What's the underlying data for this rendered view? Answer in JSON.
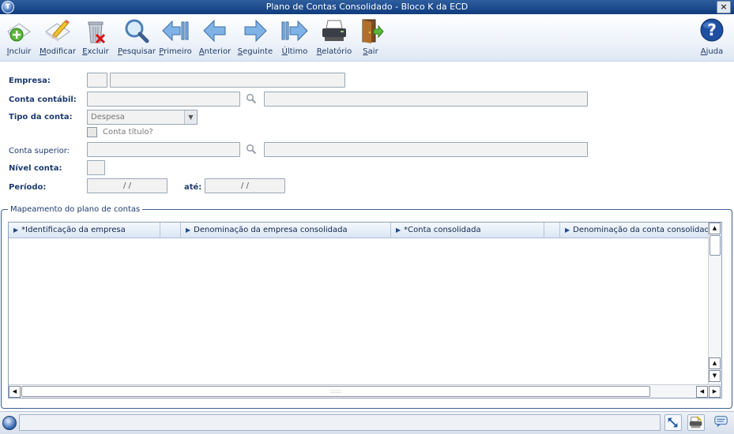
{
  "window": {
    "title": "Plano de Contas Consolidado - Bloco K da ECD",
    "close_label": "×",
    "app_icon_glyph": "T"
  },
  "toolbar": {
    "items": [
      {
        "label": "Incluir",
        "icon": "include-icon"
      },
      {
        "label": "Modificar",
        "icon": "modify-icon"
      },
      {
        "label": "Excluir",
        "icon": "delete-icon"
      },
      {
        "label": "Pesquisar",
        "icon": "search-icon"
      },
      {
        "label": "Primeiro",
        "icon": "first-icon"
      },
      {
        "label": "Anterior",
        "icon": "previous-icon"
      },
      {
        "label": "Seguinte",
        "icon": "next-icon"
      },
      {
        "label": "Último",
        "icon": "last-icon"
      },
      {
        "label": "Relatório",
        "icon": "printer-icon"
      },
      {
        "label": "Sair",
        "icon": "exit-door-icon"
      }
    ],
    "help_label": "Ajuda",
    "help_glyph": "?"
  },
  "form": {
    "empresa_label": "Empresa:",
    "conta_contabil_label": "Conta contábil:",
    "tipo_conta_label": "Tipo da conta:",
    "tipo_conta_value": "Despesa",
    "conta_titulo_label": "Conta título?",
    "conta_superior_label": "Conta superior:",
    "nivel_conta_label": "Nível conta:",
    "periodo_label": "Período:",
    "periodo_inicio_value": "/ /",
    "ate_label": "até:",
    "periodo_fim_value": "/ /"
  },
  "group": {
    "title": "Mapeamento do plano de contas",
    "columns": [
      "*Identificação da empresa",
      "Denominação da empresa consolidada",
      "*Conta consolidada",
      "Denominação da conta consolidada"
    ]
  },
  "colors": {
    "titlebar": "#0f3c7d",
    "label": "#1d3b70",
    "border": "#3d5e8f"
  }
}
